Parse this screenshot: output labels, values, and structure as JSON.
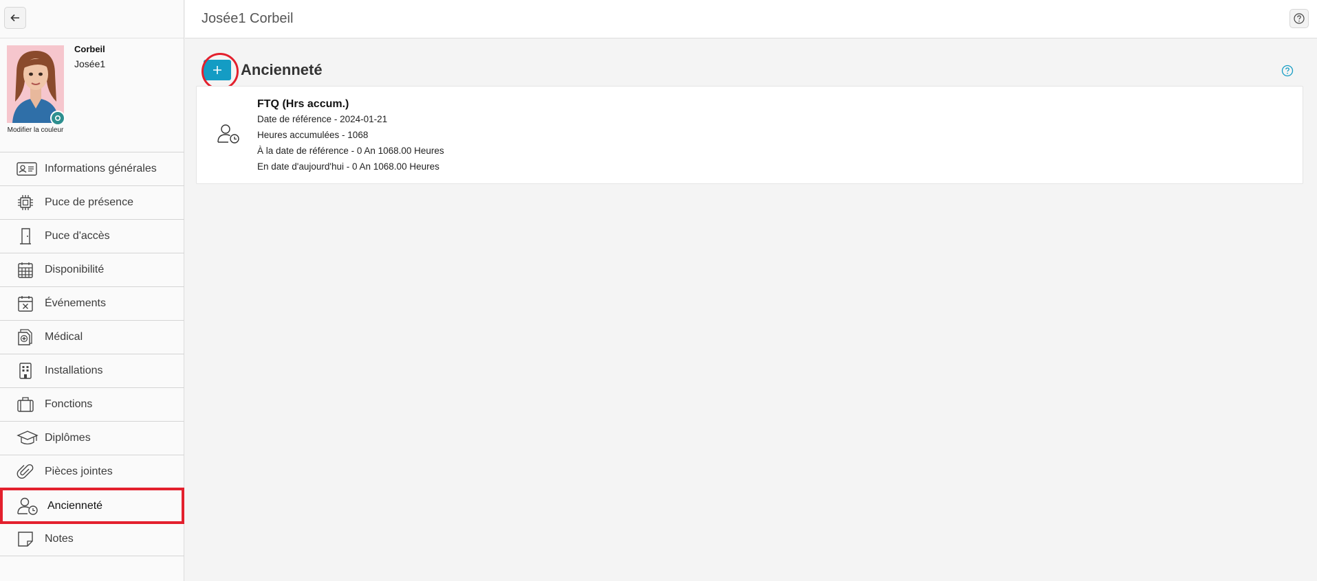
{
  "header": {
    "title": "Josée1 Corbeil"
  },
  "profile": {
    "last_name": "Corbeil",
    "first_name": "Josée1",
    "modify_color_label": "Modifier la couleur"
  },
  "sidebar": {
    "items": [
      {
        "label": "Informations générales",
        "icon": "id-card-icon"
      },
      {
        "label": "Puce de présence",
        "icon": "chip-icon"
      },
      {
        "label": "Puce d'accès",
        "icon": "door-icon"
      },
      {
        "label": "Disponibilité",
        "icon": "calendar-grid-icon"
      },
      {
        "label": "Événements",
        "icon": "calendar-x-icon"
      },
      {
        "label": "Médical",
        "icon": "medical-file-icon"
      },
      {
        "label": "Installations",
        "icon": "building-icon"
      },
      {
        "label": "Fonctions",
        "icon": "briefcase-icon"
      },
      {
        "label": "Diplômes",
        "icon": "graduation-cap-icon"
      },
      {
        "label": "Pièces jointes",
        "icon": "paperclip-icon"
      },
      {
        "label": "Ancienneté",
        "icon": "user-clock-icon",
        "active": true
      },
      {
        "label": "Notes",
        "icon": "note-icon"
      }
    ]
  },
  "section": {
    "title": "Ancienneté",
    "add_label": "+"
  },
  "card": {
    "title": "FTQ (Hrs accum.)",
    "lines": [
      "Date de référence - 2024-01-21",
      "Heures accumulées - 1068",
      "À la date de référence - 0 An 1068.00 Heures",
      "En date d'aujourd'hui - 0 An 1068.00 Heures"
    ]
  },
  "colors": {
    "accent": "#149cc4",
    "highlight": "#e3202d"
  }
}
